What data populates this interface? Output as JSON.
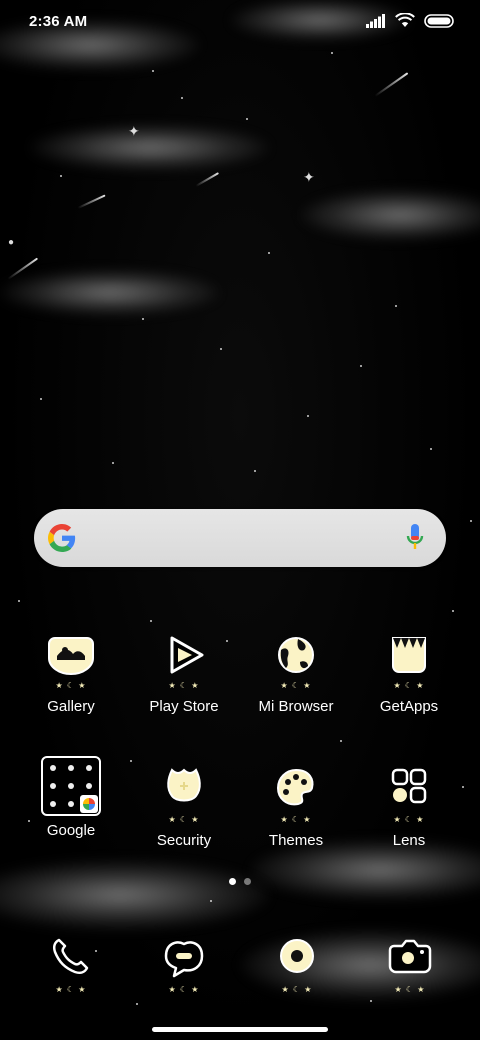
{
  "status_bar": {
    "time": "2:36 AM",
    "icons": [
      "signal-icon",
      "wifi-icon",
      "battery-icon"
    ]
  },
  "search": {
    "provider_icon": "google-g-icon",
    "voice_icon": "microphone-icon"
  },
  "apps_row1": [
    {
      "label": "Gallery",
      "icon": "gallery-icon"
    },
    {
      "label": "Play Store",
      "icon": "play-store-icon"
    },
    {
      "label": "Mi Browser",
      "icon": "browser-globe-icon"
    },
    {
      "label": "GetApps",
      "icon": "getapps-bag-icon"
    }
  ],
  "apps_row2": [
    {
      "label": "Google",
      "icon": "google-folder-icon"
    },
    {
      "label": "Security",
      "icon": "security-shield-icon"
    },
    {
      "label": "Themes",
      "icon": "palette-icon"
    },
    {
      "label": "Lens",
      "icon": "lens-grid-icon"
    }
  ],
  "page_indicator": {
    "pages": 2,
    "current": 1
  },
  "dock": [
    {
      "icon": "phone-icon"
    },
    {
      "icon": "messages-icon"
    },
    {
      "icon": "browser-donut-icon"
    },
    {
      "icon": "camera-icon"
    }
  ],
  "colors": {
    "icon_fill": "#fbf3c6",
    "icon_outline": "#ffffff",
    "background": "#000000"
  }
}
